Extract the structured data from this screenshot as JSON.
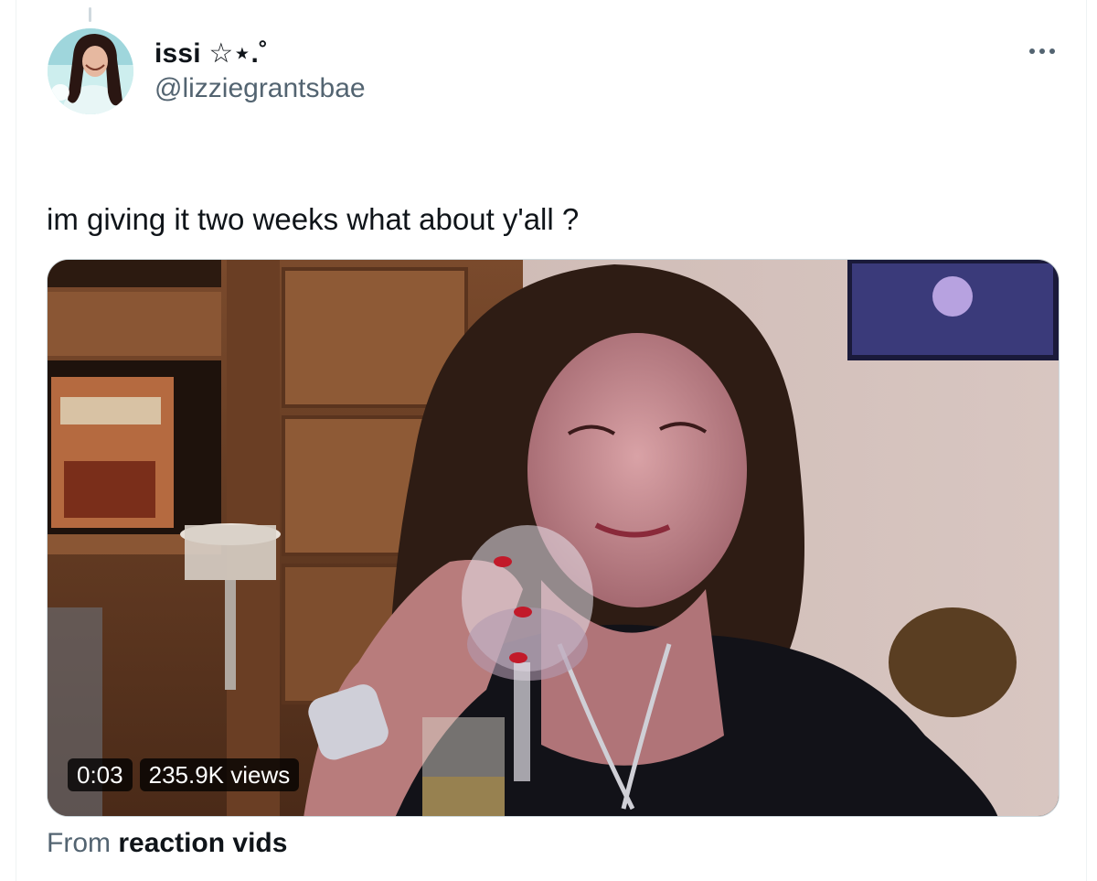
{
  "user": {
    "display_name": "issi ☆⋆.˚",
    "handle": "@lizziegrantsbae"
  },
  "tweet": {
    "text": "im giving it two weeks what about y'all ?"
  },
  "media": {
    "duration": "0:03",
    "views": "235.9K views"
  },
  "source": {
    "prefix": "From",
    "name": "reaction vids"
  },
  "icons": {
    "more": "more-horizontal-icon"
  },
  "colors": {
    "text_primary": "#0f1419",
    "text_secondary": "#536471",
    "border": "#cfd9de"
  }
}
